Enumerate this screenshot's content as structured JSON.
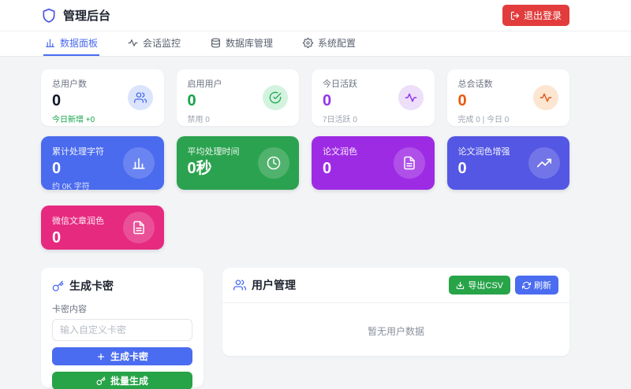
{
  "header": {
    "title": "管理后台",
    "logout_label": "退出登录"
  },
  "tabs": [
    {
      "label": "数据面板",
      "active": true
    },
    {
      "label": "会话监控",
      "active": false
    },
    {
      "label": "数据库管理",
      "active": false
    },
    {
      "label": "系统配置",
      "active": false
    }
  ],
  "stat_cards": [
    {
      "label": "总用户数",
      "value": "0",
      "sub": "今日新增 +0",
      "icon": "users-icon"
    },
    {
      "label": "启用用户",
      "value": "0",
      "sub": "禁用 0",
      "icon": "check-circle-icon"
    },
    {
      "label": "今日活跃",
      "value": "0",
      "sub": "7日活跃 0",
      "icon": "activity-icon"
    },
    {
      "label": "总会话数",
      "value": "0",
      "sub": "完成 0 | 今日 0",
      "icon": "activity-icon"
    }
  ],
  "metric_cards": [
    {
      "label": "累计处理字符",
      "value": "0",
      "sub": "约 0K 字符",
      "icon": "bar-chart-icon"
    },
    {
      "label": "平均处理时间",
      "value": "0秒",
      "sub": "",
      "icon": "clock-icon"
    },
    {
      "label": "论文润色",
      "value": "0",
      "sub": "",
      "icon": "file-text-icon"
    },
    {
      "label": "论文润色增强",
      "value": "0",
      "sub": "",
      "icon": "trending-up-icon"
    }
  ],
  "extra_card": {
    "label": "微信文章润色",
    "value": "0",
    "icon": "file-text-icon"
  },
  "keygen": {
    "title": "生成卡密",
    "field_label": "卡密内容",
    "placeholder": "输入自定义卡密",
    "input_value": "",
    "generate_label": "生成卡密",
    "batch_label": "批量生成"
  },
  "users": {
    "title": "用户管理",
    "export_label": "导出CSV",
    "refresh_label": "刷新",
    "empty_text": "暂无用户数据"
  },
  "colors": {
    "primary_blue": "#4a6cf0",
    "success_green": "#27a348",
    "danger_red": "#e23c3c",
    "card_blue": "#4a6bee",
    "card_green": "#2ba24f",
    "card_purple": "#9e2be4",
    "card_indigo": "#5457e3",
    "card_pink": "#e62a80",
    "value_green": "#16a34a",
    "value_purple": "#9333ea",
    "value_orange": "#ea580c"
  }
}
